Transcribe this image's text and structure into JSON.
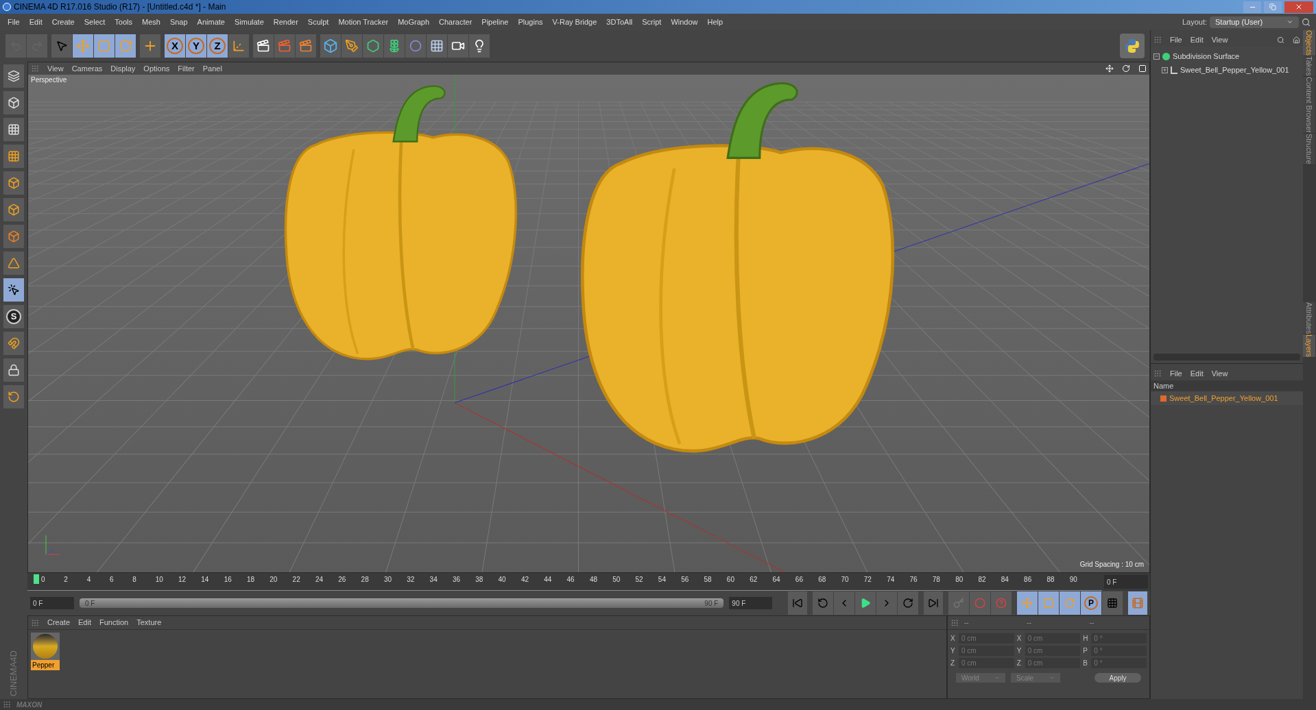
{
  "title_bar": {
    "title": "CINEMA 4D R17.016 Studio (R17) - [Untitled.c4d *] - Main"
  },
  "menu_bar": [
    "File",
    "Edit",
    "Create",
    "Select",
    "Tools",
    "Mesh",
    "Snap",
    "Animate",
    "Simulate",
    "Render",
    "Sculpt",
    "Motion Tracker",
    "MoGraph",
    "Character",
    "Pipeline",
    "Plugins",
    "V-Ray Bridge",
    "3DToAll",
    "Script",
    "Window",
    "Help"
  ],
  "layout": {
    "label": "Layout:",
    "value": "Startup (User)"
  },
  "toolbar": {
    "axis_buttons": [
      {
        "label": "X",
        "selected": true
      },
      {
        "label": "Y",
        "selected": true
      },
      {
        "label": "Z",
        "selected": true
      }
    ]
  },
  "left_tools": {
    "snap_letter": "S"
  },
  "viewport": {
    "menu": [
      "View",
      "Cameras",
      "Display",
      "Options",
      "Filter",
      "Panel"
    ],
    "camera": "Perspective",
    "grid_spacing": "Grid Spacing : 10 cm"
  },
  "timeline": {
    "ticks": [
      "0",
      "2",
      "4",
      "6",
      "8",
      "10",
      "12",
      "14",
      "16",
      "18",
      "20",
      "22",
      "24",
      "26",
      "28",
      "30",
      "32",
      "34",
      "36",
      "38",
      "40",
      "42",
      "44",
      "46",
      "48",
      "50",
      "52",
      "54",
      "56",
      "58",
      "60",
      "62",
      "64",
      "66",
      "68",
      "70",
      "72",
      "74",
      "76",
      "78",
      "80",
      "82",
      "84",
      "86",
      "88",
      "90"
    ],
    "playhead": {
      "level": 0
    },
    "range": {
      "level": 1
    },
    "current_frame": "0 F",
    "start_field": "0 F",
    "range_start": "0 F",
    "range_end": "90 F",
    "end_field": "90 F"
  },
  "record": {
    "param_letter": "P"
  },
  "materials": {
    "menu": [
      "Create",
      "Edit",
      "Function",
      "Texture"
    ],
    "items": [
      {
        "name": "Pepper",
        "selected": true
      }
    ]
  },
  "coordinates": {
    "headers": [
      "--",
      "--",
      "--"
    ],
    "rows": [
      {
        "labels": [
          "X",
          "X",
          "H"
        ],
        "values": [
          "0 cm",
          "0 cm",
          "0 °"
        ]
      },
      {
        "labels": [
          "Y",
          "Y",
          "P"
        ],
        "values": [
          "0 cm",
          "0 cm",
          "0 °"
        ]
      },
      {
        "labels": [
          "Z",
          "Z",
          "B"
        ],
        "values": [
          "0 cm",
          "0 cm",
          "0 °"
        ]
      }
    ],
    "dropdowns": [
      "World",
      "Scale"
    ],
    "apply": "Apply"
  },
  "objects_panel": {
    "menu": [
      "File",
      "Edit",
      "View"
    ],
    "tree": [
      {
        "name": "Subdivision Surface",
        "expanded": true,
        "children": [
          {
            "name": "Sweet_Bell_Pepper_Yellow_001",
            "expanded": false
          }
        ]
      }
    ]
  },
  "layers_panel": {
    "menu": [
      "File",
      "Edit",
      "View"
    ],
    "column": "Name",
    "items": [
      {
        "name": "Sweet_Bell_Pepper_Yellow_001",
        "color": "#e0692c"
      }
    ]
  },
  "side_tabs_top": [
    {
      "label": "Objects",
      "selected": true
    },
    {
      "label": "Takes",
      "selected": false
    },
    {
      "label": "Content Browser",
      "selected": false
    },
    {
      "label": "Structure",
      "selected": false
    }
  ],
  "side_tabs_bottom": [
    {
      "label": "Attributes",
      "selected": false
    },
    {
      "label": "Layers",
      "selected": true
    }
  ],
  "brand": {
    "company": "MAXON",
    "product": "CINEMA4D"
  }
}
